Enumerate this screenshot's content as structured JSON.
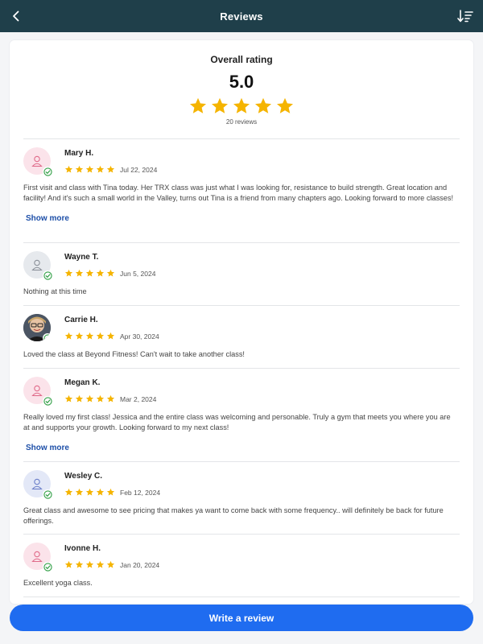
{
  "header": {
    "title": "Reviews",
    "back_icon": "chevron-left-icon",
    "sort_icon": "sort-descending-icon"
  },
  "summary": {
    "label": "Overall rating",
    "score": "5.0",
    "stars": 5,
    "count": "20 reviews",
    "star_color": "#f5b400"
  },
  "reviews": [
    {
      "name": "Mary H.",
      "date": "Jul 22, 2024",
      "stars": 5,
      "avatar": "pink",
      "text": "First visit and class with Tina today. Her TRX class was just what I was looking for, resistance to build strength. Great location and facility! And it's such a small world in the Valley, turns out Tina is a friend from many chapters ago. Looking forward to more classes!",
      "show_more": "Show more"
    },
    {
      "name": "Wayne T.",
      "date": "Jun 5, 2024",
      "stars": 5,
      "avatar": "gray",
      "text": "Nothing at this time"
    },
    {
      "name": "Carrie H.",
      "date": "Apr 30, 2024",
      "stars": 5,
      "avatar": "photo",
      "text": "Loved the class at Beyond Fitness! Can't wait to take another class!"
    },
    {
      "name": "Megan K.",
      "date": "Mar 2, 2024",
      "stars": 5,
      "avatar": "pink",
      "text": "Really loved my first class! Jessica and the entire class was welcoming and personable. Truly a gym that meets you where you are at and supports your growth. Looking forward to my next class!",
      "show_more": "Show more"
    },
    {
      "name": "Wesley C.",
      "date": "Feb 12, 2024",
      "stars": 5,
      "avatar": "blue",
      "text": "Great class and awesome to see pricing that makes ya want to come back with some frequency.. will definitely be back for future offerings."
    },
    {
      "name": "Ivonne H.",
      "date": "Jan 20, 2024",
      "stars": 5,
      "avatar": "pink",
      "text": "Excellent yoga class."
    }
  ],
  "footer": {
    "write_review_label": "Write a review",
    "button_color": "#1f6cf0"
  }
}
